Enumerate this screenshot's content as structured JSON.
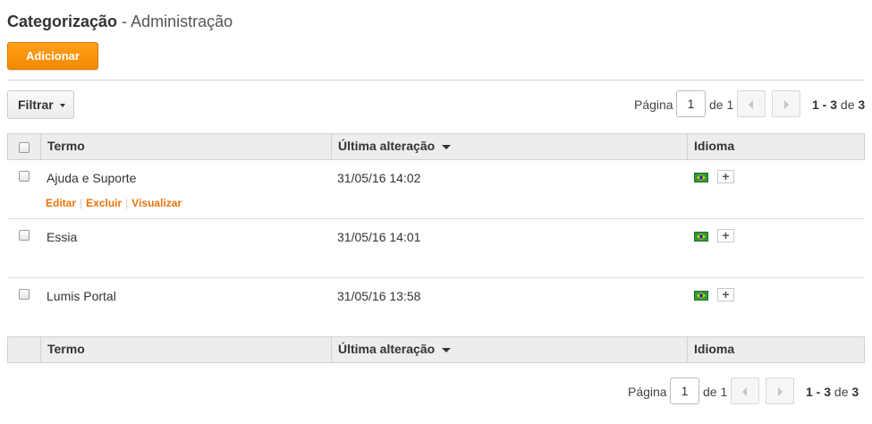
{
  "header": {
    "title": "Categorização",
    "subtitle": "- Administração"
  },
  "toolbar": {
    "add_label": "Adicionar",
    "filter_label": "Filtrar"
  },
  "pagination": {
    "page_label": "Página",
    "current_page": "1",
    "of_label": "de 1",
    "range": "1 - 3",
    "range_of": "de",
    "total": "3"
  },
  "table": {
    "columns": {
      "term": "Termo",
      "last_modified": "Última alteração",
      "language": "Idioma"
    },
    "sort": {
      "column": "last_modified",
      "direction": "descending"
    },
    "rows": [
      {
        "term": "Ajuda e Suporte",
        "modified": "31/05/16 14:02",
        "language_flag": "brazil-flag",
        "actions": [
          "Editar",
          "Excluir",
          "Visualizar"
        ]
      },
      {
        "term": "Essia",
        "modified": "31/05/16 14:01",
        "language_flag": "brazil-flag"
      },
      {
        "term": "Lumis Portal",
        "modified": "31/05/16 13:58",
        "language_flag": "brazil-flag"
      }
    ],
    "add_language_symbol": "+"
  },
  "colors": {
    "accent": "#f39200",
    "link": "#e8740c",
    "header_bg": "#ededed"
  }
}
